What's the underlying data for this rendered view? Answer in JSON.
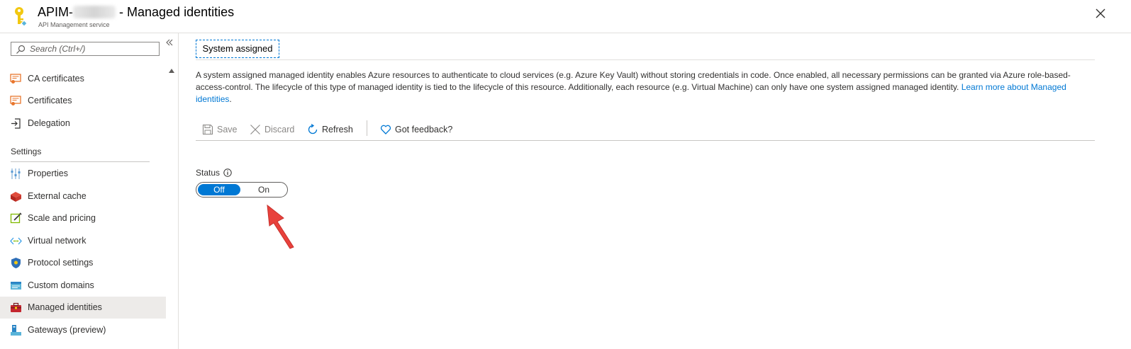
{
  "header": {
    "title_prefix": "APIM-",
    "title_suffix": " - Managed identities",
    "subtitle": "API Management service",
    "logo_icon": "key-icon",
    "close_icon": "close-icon"
  },
  "sidebar": {
    "search": {
      "placeholder": "Search (Ctrl+/)"
    },
    "collapse_icon": "double-chevron-left-icon",
    "items_top": [
      {
        "label": "CA certificates",
        "icon": "certificate-icon"
      },
      {
        "label": "Certificates",
        "icon": "certificate-icon"
      },
      {
        "label": "Delegation",
        "icon": "sign-in-icon"
      }
    ],
    "section_settings": "Settings",
    "items_settings": [
      {
        "label": "Properties",
        "icon": "sliders-icon"
      },
      {
        "label": "External cache",
        "icon": "cache-icon"
      },
      {
        "label": "Scale and pricing",
        "icon": "edit-scale-icon"
      },
      {
        "label": "Virtual network",
        "icon": "network-icon"
      },
      {
        "label": "Protocol settings",
        "icon": "shield-icon"
      },
      {
        "label": "Custom domains",
        "icon": "domain-icon"
      },
      {
        "label": "Managed identities",
        "icon": "identity-icon",
        "selected": true
      },
      {
        "label": "Gateways (preview)",
        "icon": "gateway-icon"
      }
    ]
  },
  "main": {
    "tab": "System assigned",
    "description": "A system assigned managed identity enables Azure resources to authenticate to cloud services (e.g. Azure Key Vault) without storing credentials in code. Once enabled, all necessary permissions can be granted via Azure role-based-access-control. The lifecycle of this type of managed identity is tied to the lifecycle of this resource. Additionally, each resource (e.g. Virtual Machine) can only have one system assigned managed identity.",
    "learn_more": "Learn more about Managed identities",
    "description_end": ".",
    "toolbar": {
      "save": "Save",
      "discard": "Discard",
      "refresh": "Refresh",
      "feedback": "Got feedback?"
    },
    "status": {
      "label": "Status",
      "off": "Off",
      "on": "On",
      "selected": "Off"
    }
  },
  "colors": {
    "accent": "#0078d4",
    "arrow": "#e8413c",
    "selected_bg": "#edebe9"
  }
}
